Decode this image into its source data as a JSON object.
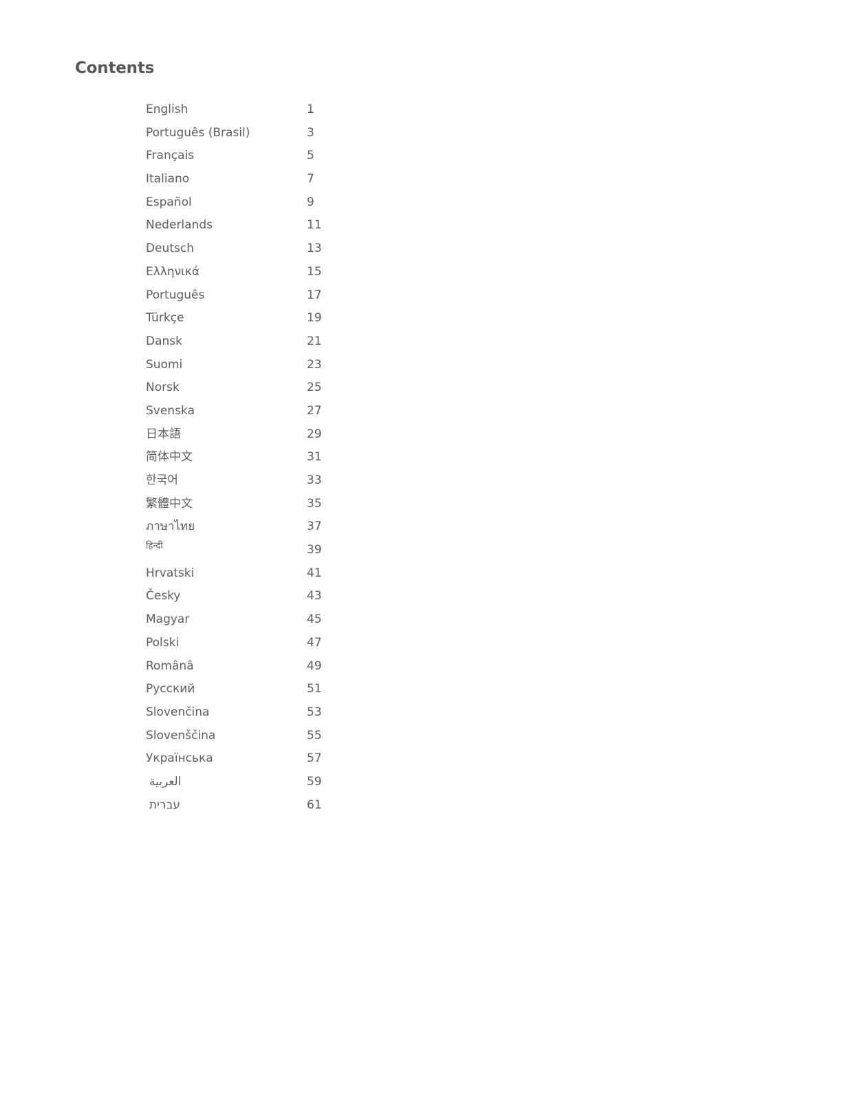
{
  "title": "Contents",
  "entries": [
    {
      "label": "English",
      "page": "1"
    },
    {
      "label": "Português (Brasil)",
      "page": "3"
    },
    {
      "label": "Français",
      "page": "5"
    },
    {
      "label": "Italiano",
      "page": "7"
    },
    {
      "label": "Español",
      "page": "9"
    },
    {
      "label": "Nederlands",
      "page": "11"
    },
    {
      "label": "Deutsch",
      "page": "13"
    },
    {
      "label": "Ελληνικά",
      "page": "15"
    },
    {
      "label": "Português",
      "page": "17"
    },
    {
      "label": "Türkçe",
      "page": "19"
    },
    {
      "label": "Dansk",
      "page": "21"
    },
    {
      "label": "Suomi",
      "page": "23"
    },
    {
      "label": "Norsk",
      "page": "25"
    },
    {
      "label": "Svenska",
      "page": "27"
    },
    {
      "label": "日本語",
      "page": "29"
    },
    {
      "label": "简体中文",
      "page": "31"
    },
    {
      "label": "한국어",
      "page": "33"
    },
    {
      "label": "繁體中文",
      "page": "35"
    },
    {
      "label": "ภาษาไทย",
      "page": "37"
    },
    {
      "label": "हिन्दी",
      "page": "39"
    },
    {
      "label": "Hrvatski",
      "page": "41"
    },
    {
      "label": "Česky",
      "page": "43"
    },
    {
      "label": "Magyar",
      "page": "45"
    },
    {
      "label": "Polski",
      "page": "47"
    },
    {
      "label": "Românâ",
      "page": "49"
    },
    {
      "label": "Русский",
      "page": "51"
    },
    {
      "label": "Slovenčina",
      "page": "53"
    },
    {
      "label": "Slovenščina",
      "page": "55"
    },
    {
      "label": "Українська",
      "page": "57"
    },
    {
      "label": "العربية",
      "page": "59"
    },
    {
      "label": "עברית",
      "page": "61"
    }
  ]
}
